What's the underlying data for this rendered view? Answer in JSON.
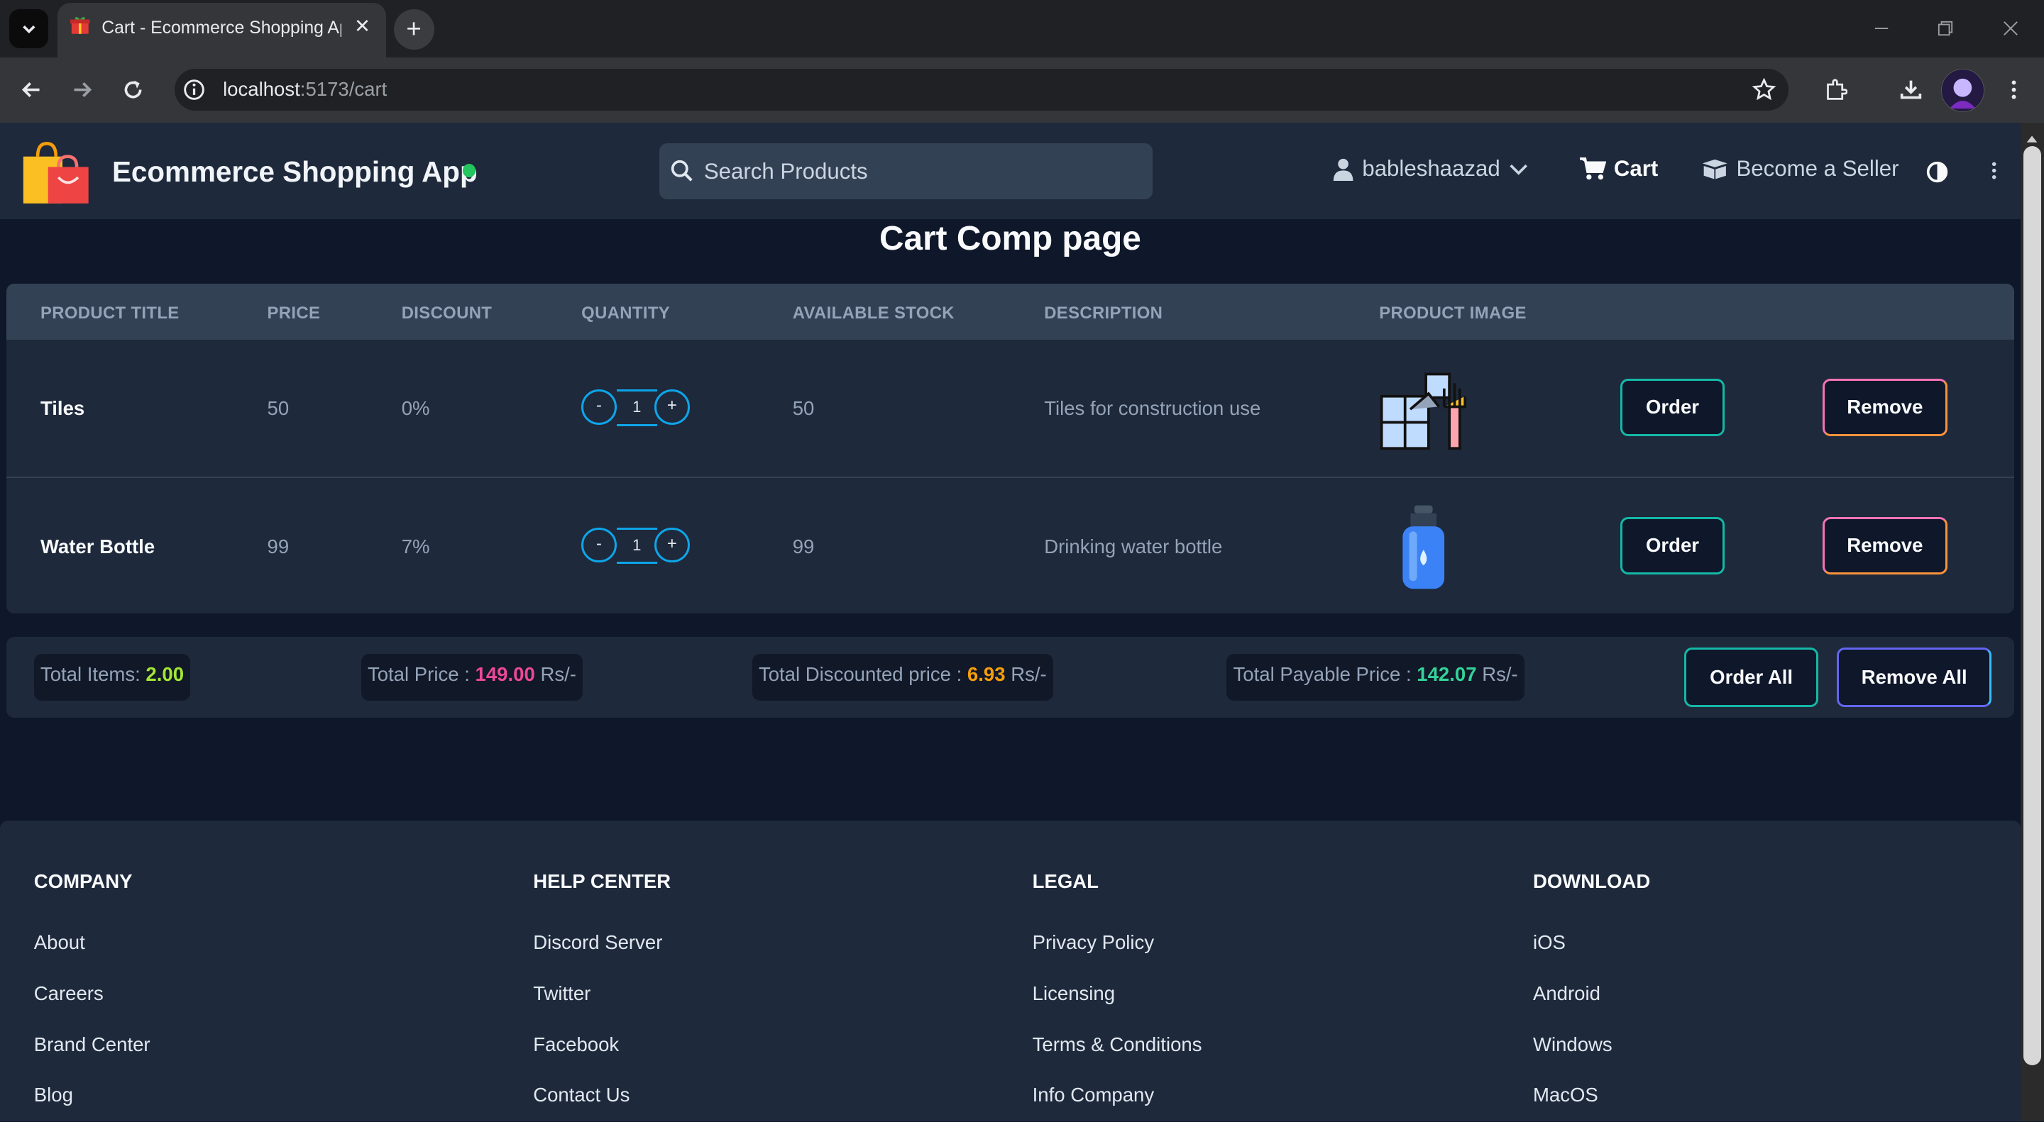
{
  "browser": {
    "tab_title": "Cart - Ecommerce Shopping Ap",
    "url_host": "localhost",
    "url_rest": ":5173/cart"
  },
  "header": {
    "brand": "Ecommerce Shopping App",
    "search_placeholder": "Search Products",
    "user": "bableshaazad",
    "cart": "Cart",
    "seller": "Become a Seller"
  },
  "page_title": "Cart Comp page",
  "table": {
    "columns": [
      "PRODUCT TITLE",
      "PRICE",
      "DISCOUNT",
      "QUANTITY",
      "AVAILABLE STOCK",
      "DESCRIPTION",
      "PRODUCT IMAGE"
    ],
    "rows": [
      {
        "title": "Tiles",
        "price": "50",
        "discount": "0%",
        "quantity": "1",
        "stock": "50",
        "description": "Tiles for construction use",
        "image": "tiles-icon",
        "order": "Order",
        "remove": "Remove"
      },
      {
        "title": "Water Bottle",
        "price": "99",
        "discount": "7%",
        "quantity": "1",
        "stock": "99",
        "description": "Drinking water bottle",
        "image": "water-bottle-icon",
        "order": "Order",
        "remove": "Remove"
      }
    ],
    "minus": "-",
    "plus": "+"
  },
  "totals": {
    "items_label": "Total Items:",
    "items_value": "2.00",
    "price_label": "Total Price :",
    "price_value": "149.00",
    "discount_label": "Total Discounted price :",
    "discount_value": "6.93",
    "payable_label": "Total Payable Price :",
    "payable_value": "142.07",
    "unit": "Rs/-",
    "order_all": "Order All",
    "remove_all": "Remove All"
  },
  "footer": {
    "columns": [
      {
        "heading": "COMPANY",
        "links": [
          "About",
          "Careers",
          "Brand Center",
          "Blog"
        ]
      },
      {
        "heading": "HELP CENTER",
        "links": [
          "Discord Server",
          "Twitter",
          "Facebook",
          "Contact Us"
        ]
      },
      {
        "heading": "LEGAL",
        "links": [
          "Privacy Policy",
          "Licensing",
          "Terms & Conditions",
          "Info Company"
        ]
      },
      {
        "heading": "DOWNLOAD",
        "links": [
          "iOS",
          "Android",
          "Windows",
          "MacOS"
        ]
      }
    ]
  },
  "colors": {
    "background": "#0f172a",
    "panel": "#1e293b",
    "header_row": "#334155",
    "order_border": "#14b8a6",
    "remove_border": "#f472b6",
    "stepper": "#0ea5e9"
  }
}
